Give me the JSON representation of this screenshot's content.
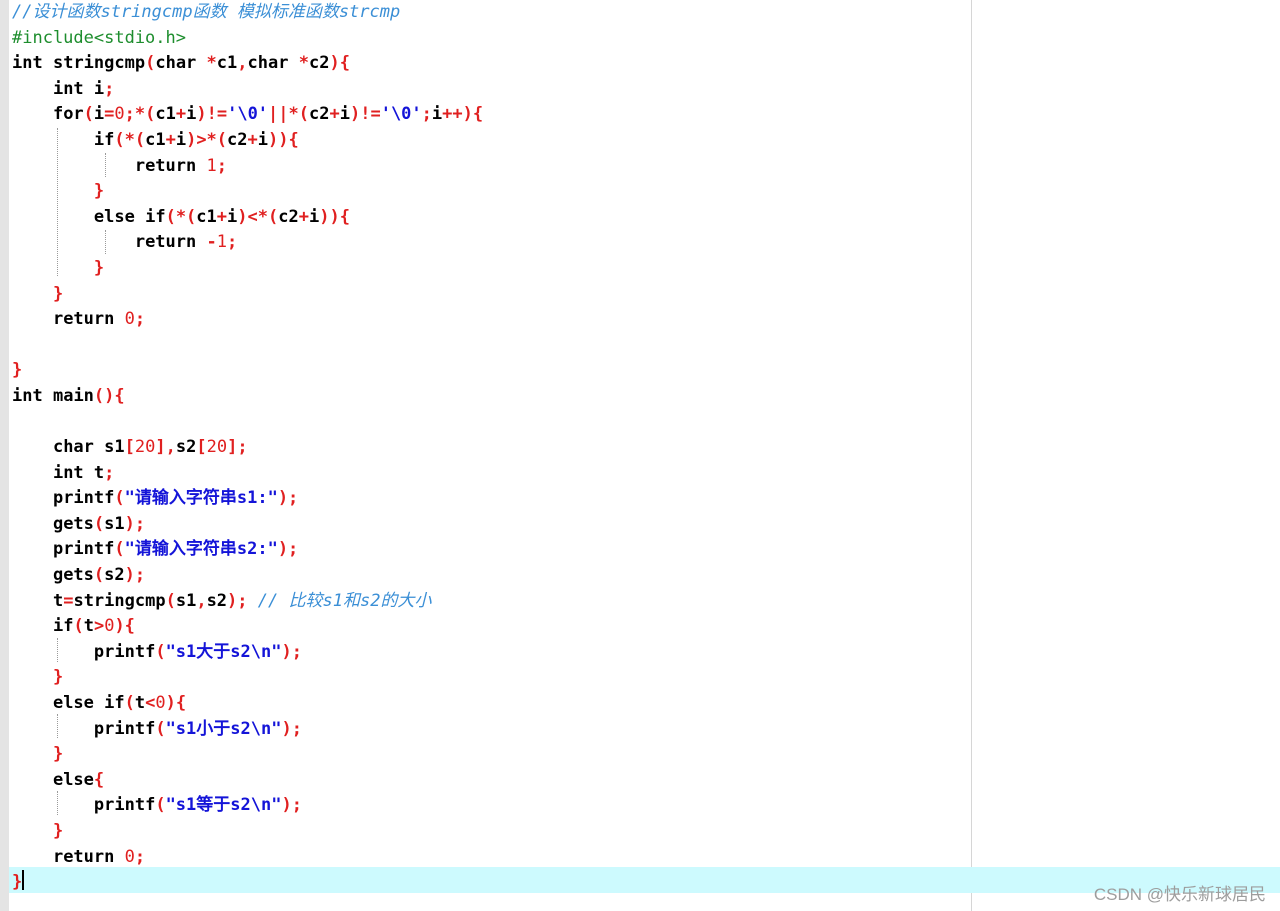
{
  "code_lines": [
    [
      [
        "comment",
        "//设计函数stringcmp函数 模拟标准函数strcmp"
      ]
    ],
    [
      [
        "pre",
        "#include<stdio.h>"
      ]
    ],
    [
      [
        "kw",
        "int"
      ],
      [
        "sp",
        " "
      ],
      [
        "id",
        "stringcmp"
      ],
      [
        "op",
        "("
      ],
      [
        "kw",
        "char"
      ],
      [
        "sp",
        " "
      ],
      [
        "op",
        "*"
      ],
      [
        "id",
        "c1"
      ],
      [
        "op",
        ","
      ],
      [
        "kw",
        "char"
      ],
      [
        "sp",
        " "
      ],
      [
        "op",
        "*"
      ],
      [
        "id",
        "c2"
      ],
      [
        "op",
        "){"
      ]
    ],
    [
      [
        "sp",
        "    "
      ],
      [
        "kw",
        "int"
      ],
      [
        "sp",
        " "
      ],
      [
        "id",
        "i"
      ],
      [
        "op",
        ";"
      ]
    ],
    [
      [
        "sp",
        "    "
      ],
      [
        "kw",
        "for"
      ],
      [
        "op",
        "("
      ],
      [
        "id",
        "i"
      ],
      [
        "op",
        "="
      ],
      [
        "num",
        "0"
      ],
      [
        "op",
        ";*("
      ],
      [
        "id",
        "c1"
      ],
      [
        "op",
        "+"
      ],
      [
        "id",
        "i"
      ],
      [
        "op",
        ")!="
      ],
      [
        "str",
        "'\\0'"
      ],
      [
        "op",
        "||*("
      ],
      [
        "id",
        "c2"
      ],
      [
        "op",
        "+"
      ],
      [
        "id",
        "i"
      ],
      [
        "op",
        ")!="
      ],
      [
        "str",
        "'\\0'"
      ],
      [
        "op",
        ";"
      ],
      [
        "id",
        "i"
      ],
      [
        "op",
        "++){"
      ]
    ],
    [
      [
        "sp",
        "        "
      ],
      [
        "kw",
        "if"
      ],
      [
        "op",
        "(*("
      ],
      [
        "id",
        "c1"
      ],
      [
        "op",
        "+"
      ],
      [
        "id",
        "i"
      ],
      [
        "op",
        ")>*("
      ],
      [
        "id",
        "c2"
      ],
      [
        "op",
        "+"
      ],
      [
        "id",
        "i"
      ],
      [
        "op",
        ")){"
      ]
    ],
    [
      [
        "sp",
        "            "
      ],
      [
        "kw",
        "return"
      ],
      [
        "sp",
        " "
      ],
      [
        "num",
        "1"
      ],
      [
        "op",
        ";"
      ]
    ],
    [
      [
        "sp",
        "        "
      ],
      [
        "op",
        "}"
      ]
    ],
    [
      [
        "sp",
        "        "
      ],
      [
        "kw",
        "else"
      ],
      [
        "sp",
        " "
      ],
      [
        "kw",
        "if"
      ],
      [
        "op",
        "(*("
      ],
      [
        "id",
        "c1"
      ],
      [
        "op",
        "+"
      ],
      [
        "id",
        "i"
      ],
      [
        "op",
        ")<*("
      ],
      [
        "id",
        "c2"
      ],
      [
        "op",
        "+"
      ],
      [
        "id",
        "i"
      ],
      [
        "op",
        ")){"
      ]
    ],
    [
      [
        "sp",
        "            "
      ],
      [
        "kw",
        "return"
      ],
      [
        "sp",
        " "
      ],
      [
        "op",
        "-"
      ],
      [
        "num",
        "1"
      ],
      [
        "op",
        ";"
      ]
    ],
    [
      [
        "sp",
        "        "
      ],
      [
        "op",
        "}"
      ]
    ],
    [
      [
        "sp",
        "    "
      ],
      [
        "op",
        "}"
      ]
    ],
    [
      [
        "sp",
        "    "
      ],
      [
        "kw",
        "return"
      ],
      [
        "sp",
        " "
      ],
      [
        "num",
        "0"
      ],
      [
        "op",
        ";"
      ]
    ],
    [],
    [
      [
        "op",
        "}"
      ]
    ],
    [
      [
        "kw",
        "int"
      ],
      [
        "sp",
        " "
      ],
      [
        "id",
        "main"
      ],
      [
        "op",
        "(){"
      ]
    ],
    [],
    [
      [
        "sp",
        "    "
      ],
      [
        "kw",
        "char"
      ],
      [
        "sp",
        " "
      ],
      [
        "id",
        "s1"
      ],
      [
        "op",
        "["
      ],
      [
        "num",
        "20"
      ],
      [
        "op",
        "],"
      ],
      [
        "id",
        "s2"
      ],
      [
        "op",
        "["
      ],
      [
        "num",
        "20"
      ],
      [
        "op",
        "];"
      ]
    ],
    [
      [
        "sp",
        "    "
      ],
      [
        "kw",
        "int"
      ],
      [
        "sp",
        " "
      ],
      [
        "id",
        "t"
      ],
      [
        "op",
        ";"
      ]
    ],
    [
      [
        "sp",
        "    "
      ],
      [
        "id",
        "printf"
      ],
      [
        "op",
        "("
      ],
      [
        "str",
        "\"请输入字符串s1:\""
      ],
      [
        "op",
        ");"
      ]
    ],
    [
      [
        "sp",
        "    "
      ],
      [
        "id",
        "gets"
      ],
      [
        "op",
        "("
      ],
      [
        "id",
        "s1"
      ],
      [
        "op",
        ");"
      ]
    ],
    [
      [
        "sp",
        "    "
      ],
      [
        "id",
        "printf"
      ],
      [
        "op",
        "("
      ],
      [
        "str",
        "\"请输入字符串s2:\""
      ],
      [
        "op",
        ");"
      ]
    ],
    [
      [
        "sp",
        "    "
      ],
      [
        "id",
        "gets"
      ],
      [
        "op",
        "("
      ],
      [
        "id",
        "s2"
      ],
      [
        "op",
        ");"
      ]
    ],
    [
      [
        "sp",
        "    "
      ],
      [
        "id",
        "t"
      ],
      [
        "op",
        "="
      ],
      [
        "id",
        "stringcmp"
      ],
      [
        "op",
        "("
      ],
      [
        "id",
        "s1"
      ],
      [
        "op",
        ","
      ],
      [
        "id",
        "s2"
      ],
      [
        "op",
        ");"
      ],
      [
        "sp",
        " "
      ],
      [
        "comment",
        "// 比较s1和s2的大小"
      ]
    ],
    [
      [
        "sp",
        "    "
      ],
      [
        "kw",
        "if"
      ],
      [
        "op",
        "("
      ],
      [
        "id",
        "t"
      ],
      [
        "op",
        ">"
      ],
      [
        "num",
        "0"
      ],
      [
        "op",
        "){"
      ]
    ],
    [
      [
        "sp",
        "        "
      ],
      [
        "id",
        "printf"
      ],
      [
        "op",
        "("
      ],
      [
        "str",
        "\"s1大于s2\\n\""
      ],
      [
        "op",
        ");"
      ]
    ],
    [
      [
        "sp",
        "    "
      ],
      [
        "op",
        "}"
      ]
    ],
    [
      [
        "sp",
        "    "
      ],
      [
        "kw",
        "else"
      ],
      [
        "sp",
        " "
      ],
      [
        "kw",
        "if"
      ],
      [
        "op",
        "("
      ],
      [
        "id",
        "t"
      ],
      [
        "op",
        "<"
      ],
      [
        "num",
        "0"
      ],
      [
        "op",
        "){"
      ]
    ],
    [
      [
        "sp",
        "        "
      ],
      [
        "id",
        "printf"
      ],
      [
        "op",
        "("
      ],
      [
        "str",
        "\"s1小于s2\\n\""
      ],
      [
        "op",
        ");"
      ]
    ],
    [
      [
        "sp",
        "    "
      ],
      [
        "op",
        "}"
      ]
    ],
    [
      [
        "sp",
        "    "
      ],
      [
        "kw",
        "else"
      ],
      [
        "op",
        "{"
      ]
    ],
    [
      [
        "sp",
        "        "
      ],
      [
        "id",
        "printf"
      ],
      [
        "op",
        "("
      ],
      [
        "str",
        "\"s1等于s2\\n\""
      ],
      [
        "op",
        ");"
      ]
    ],
    [
      [
        "sp",
        "    "
      ],
      [
        "op",
        "}"
      ]
    ],
    [
      [
        "sp",
        "    "
      ],
      [
        "kw",
        "return"
      ],
      [
        "sp",
        " "
      ],
      [
        "num",
        "0"
      ],
      [
        "op",
        ";"
      ]
    ],
    [
      [
        "op",
        "}"
      ]
    ]
  ],
  "watermark": "CSDN @快乐新球居民"
}
